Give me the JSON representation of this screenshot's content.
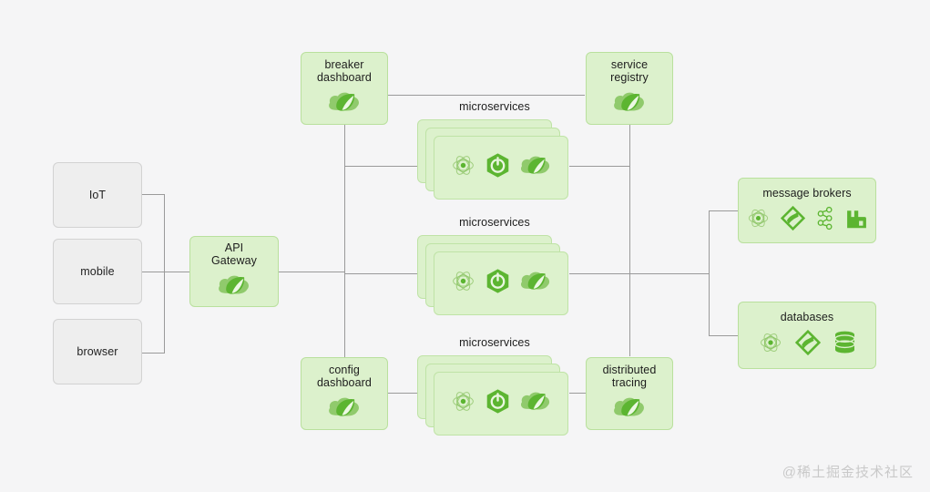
{
  "diagram": {
    "background_color": "#f5f5f6",
    "accent_green": "#5cb531",
    "box_fill_green": "#dcf1cc",
    "box_border_green": "#b9e09d",
    "client_fill": "#eeeeee",
    "client_border": "#d2d2d2",
    "wire_color": "#9a9a9a"
  },
  "clients": [
    {
      "id": "iot",
      "label": "IoT"
    },
    {
      "id": "mobile",
      "label": "mobile"
    },
    {
      "id": "browser",
      "label": "browser"
    }
  ],
  "gateway": {
    "label": "API\nGateway",
    "icon": "spring-cloud-icon"
  },
  "infrastructure": [
    {
      "id": "breaker-dashboard",
      "label": "breaker\ndashboard",
      "icon": "spring-cloud-icon"
    },
    {
      "id": "service-registry",
      "label": "service\nregistry",
      "icon": "spring-cloud-icon"
    },
    {
      "id": "config-dashboard",
      "label": "config\ndashboard",
      "icon": "spring-cloud-icon"
    },
    {
      "id": "distributed-tracing",
      "label": "distributed\ntracing",
      "icon": "spring-cloud-icon"
    }
  ],
  "microservices": [
    {
      "id": "microservices-top",
      "label": "microservices",
      "stack_count": 3,
      "icons": [
        "atom-icon",
        "spring-boot-icon",
        "spring-cloud-icon"
      ]
    },
    {
      "id": "microservices-middle",
      "label": "microservices",
      "stack_count": 3,
      "icons": [
        "atom-icon",
        "spring-boot-icon",
        "spring-cloud-icon"
      ]
    },
    {
      "id": "microservices-bottom",
      "label": "microservices",
      "stack_count": 3,
      "icons": [
        "atom-icon",
        "spring-boot-icon",
        "spring-cloud-icon"
      ]
    }
  ],
  "backends": [
    {
      "id": "message-brokers",
      "label": "message brokers",
      "icons": [
        "atom-icon",
        "rabbitmq-diamond-icon",
        "kafka-icon",
        "broker-block-icon"
      ]
    },
    {
      "id": "databases",
      "label": "databases",
      "icons": [
        "atom-icon",
        "rabbitmq-diamond-icon",
        "database-cylinder-icon"
      ]
    }
  ],
  "watermark": {
    "text": "@稀土掘金技术社区"
  }
}
